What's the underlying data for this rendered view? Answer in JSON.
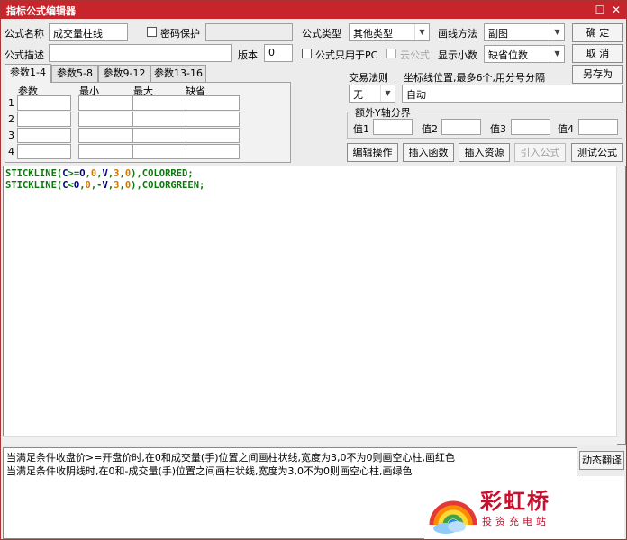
{
  "window": {
    "title": "指标公式编辑器"
  },
  "form": {
    "name_label": "公式名称",
    "name_value": "成交量柱线",
    "password_label": "密码保护",
    "password_value": "",
    "desc_label": "公式描述",
    "desc_value": "",
    "version_label": "版本",
    "version_value": "0",
    "type_label": "公式类型",
    "type_value": "其他类型",
    "draw_label": "画线方法",
    "draw_value": "副图",
    "pc_only_label": "公式只用于PC",
    "cloud_label": "云公式",
    "decimals_label": "显示小数",
    "decimals_value": "缺省位数",
    "trade_rule_label": "交易法则",
    "trade_rule_value": "无",
    "axis_label": "坐标线位置,最多6个,用分号分隔",
    "axis_value": "自动",
    "extra_y_label": "额外Y轴分界",
    "val1_label": "值1",
    "val2_label": "值2",
    "val3_label": "值3",
    "val4_label": "值4"
  },
  "buttons": {
    "ok": "确 定",
    "cancel": "取 消",
    "save_as": "另存为",
    "edit_op": "编辑操作",
    "insert_func": "插入函数",
    "insert_res": "插入资源",
    "import_formula": "引入公式",
    "test_formula": "测试公式",
    "dynamic_translate": "动态翻译"
  },
  "tabs": [
    "参数1-4",
    "参数5-8",
    "参数9-12",
    "参数13-16"
  ],
  "param_table": {
    "headers": [
      "参数",
      "最小",
      "最大",
      "缺省"
    ],
    "rows": [
      "1",
      "2",
      "3",
      "4"
    ]
  },
  "code_lines": [
    [
      {
        "t": "STICKLINE(",
        "c": "cg"
      },
      {
        "t": "C",
        "c": "cb"
      },
      {
        "t": ">=",
        "c": "cg"
      },
      {
        "t": "O",
        "c": "cb"
      },
      {
        "t": ",",
        "c": "cg"
      },
      {
        "t": "0",
        "c": "cn"
      },
      {
        "t": ",",
        "c": "cg"
      },
      {
        "t": "V",
        "c": "cb"
      },
      {
        "t": ",",
        "c": "cg"
      },
      {
        "t": "3",
        "c": "cn"
      },
      {
        "t": ",",
        "c": "cg"
      },
      {
        "t": "0",
        "c": "cn"
      },
      {
        "t": "),COLORRED;",
        "c": "cg"
      }
    ],
    [
      {
        "t": "STICKLINE(",
        "c": "cg"
      },
      {
        "t": "C",
        "c": "cb"
      },
      {
        "t": "<",
        "c": "cg"
      },
      {
        "t": "O",
        "c": "cb"
      },
      {
        "t": ",",
        "c": "cg"
      },
      {
        "t": "0",
        "c": "cn"
      },
      {
        "t": ",-",
        "c": "cg"
      },
      {
        "t": "V",
        "c": "cb"
      },
      {
        "t": ",",
        "c": "cg"
      },
      {
        "t": "3",
        "c": "cn"
      },
      {
        "t": ",",
        "c": "cg"
      },
      {
        "t": "0",
        "c": "cn"
      },
      {
        "t": "),COLORGREEN;",
        "c": "cg"
      }
    ]
  ],
  "description_lines": [
    "当满足条件收盘价>=开盘价时,在0和成交量(手)位置之间画柱状线,宽度为3,0不为0则画空心柱,画红色",
    "当满足条件收阴线时,在0和-成交量(手)位置之间画柱状线,宽度为3,0不为0则画空心柱,画绿色"
  ],
  "watermark": {
    "brand": "彩虹桥",
    "sub": "投资充电站"
  },
  "colors": {
    "title_bar": "#c8242b",
    "code_green": "#0a7a0a",
    "code_orange": "#cc7a00",
    "logo_red": "#c8102e"
  }
}
